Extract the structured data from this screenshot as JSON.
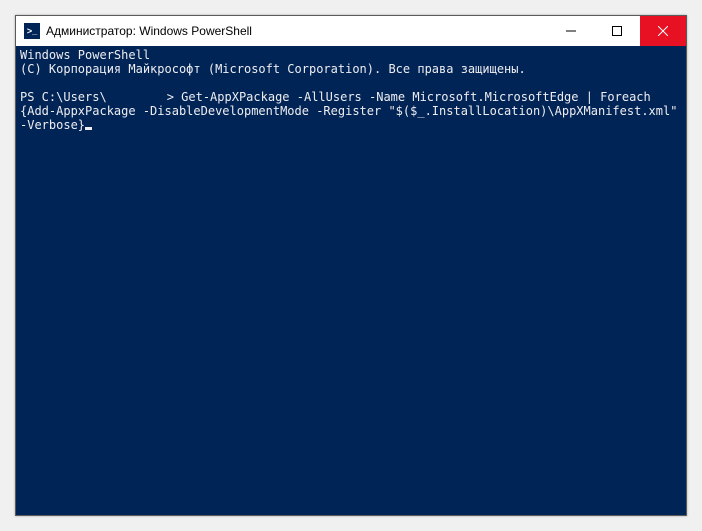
{
  "titlebar": {
    "title": "Администратор: Windows PowerShell",
    "icon_glyph": ">_"
  },
  "terminal": {
    "header_line1": "Windows PowerShell",
    "header_line2": "(C) Корпорация Майкрософт (Microsoft Corporation). Все права защищены.",
    "prompt_prefix": "PS C:\\Users\\",
    "prompt_suffix": "> ",
    "command": "Get-AppXPackage -AllUsers -Name Microsoft.MicrosoftEdge | Foreach {Add-AppxPackage -DisableDevelopmentMode -Register \"$($_.InstallLocation)\\AppXManifest.xml\" -Verbose}"
  }
}
